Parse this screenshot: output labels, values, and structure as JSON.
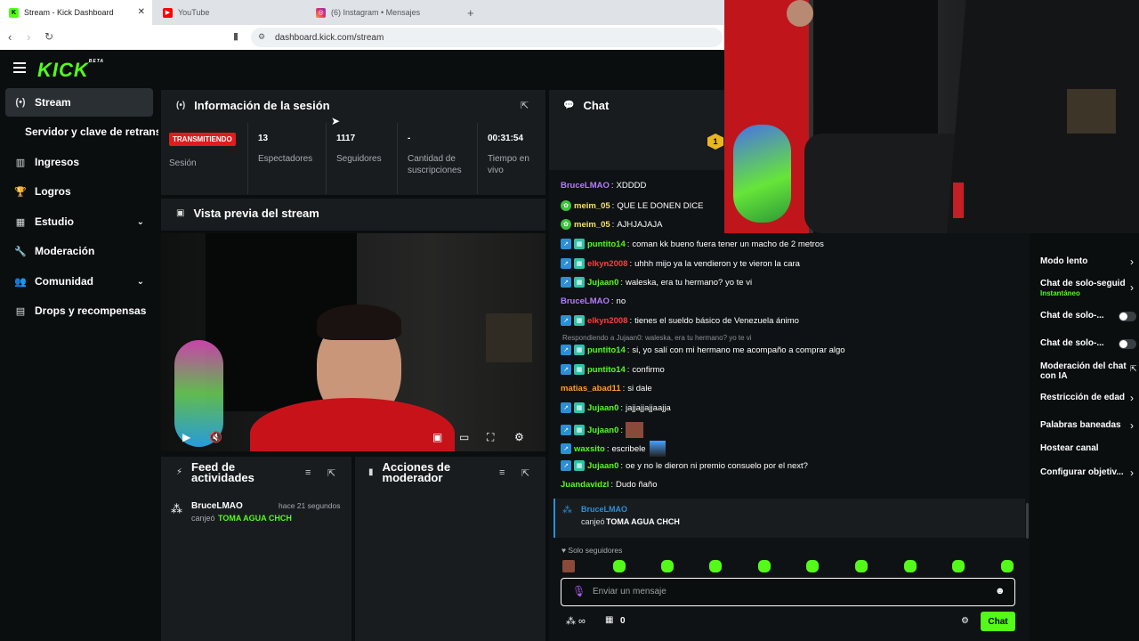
{
  "browser": {
    "tabs": [
      {
        "title": "Stream - Kick Dashboard",
        "active": true
      },
      {
        "title": "YouTube",
        "active": false
      },
      {
        "title": "(6) Instagram • Mensajes",
        "active": false
      }
    ],
    "url": "dashboard.kick.com/stream"
  },
  "brand": {
    "logo": "KICK",
    "logo_sup": "BETA",
    "accent": "#53fc18"
  },
  "sidebar": {
    "items": [
      {
        "label": "Stream",
        "icon": "broadcast-icon"
      },
      {
        "label": "Servidor y clave de retransmisión",
        "icon": ""
      },
      {
        "label": "Ingresos",
        "icon": "chart-icon"
      },
      {
        "label": "Logros",
        "icon": "trophy-icon"
      },
      {
        "label": "Estudio",
        "icon": "grid-icon"
      },
      {
        "label": "Moderación",
        "icon": "wrench-icon"
      },
      {
        "label": "Comunidad",
        "icon": "people-icon"
      },
      {
        "label": "Drops y recompensas",
        "icon": "gift-icon"
      }
    ]
  },
  "session": {
    "title": "Información de la sesión",
    "status_badge": "TRANSMITIENDO",
    "status_label": "Sesión",
    "stats": [
      {
        "value": "13",
        "label": "Espectadores"
      },
      {
        "value": "1117",
        "label": "Seguidores"
      },
      {
        "value": "-",
        "label": "Cantidad de suscripciones"
      },
      {
        "value": "00:31:54",
        "label": "Tiempo en vivo"
      }
    ]
  },
  "preview": {
    "title": "Vista previa del stream"
  },
  "activity": {
    "title": "Feed de actividades",
    "items": [
      {
        "user": "BruceLMAO",
        "time": "hace 21 segundos",
        "action": "canjeó",
        "reward": "TOMA AGUA CHCH"
      }
    ]
  },
  "mod_actions": {
    "title": "Acciones de moderador"
  },
  "chat": {
    "title": "Chat",
    "messages": [
      {
        "user": "BruceLMAO",
        "color": "#b57bff",
        "text": "XDDDD",
        "badges": []
      },
      {
        "user": "meim_05",
        "color": "#f6e35a",
        "text": "QUE LE DONEN DICE",
        "badges": [
          "green"
        ]
      },
      {
        "user": "meim_05",
        "color": "#f6e35a",
        "text": "AJHJAJAJA",
        "badges": [
          "green"
        ]
      },
      {
        "user": "puntito14",
        "color": "#53fc18",
        "text": "coman kk bueno fuera tener un macho de 2 metros",
        "badges": [
          "blue",
          "teal"
        ]
      },
      {
        "user": "elkyn2008",
        "color": "#ff3b3b",
        "text": "uhhh mijo ya la vendieron y te vieron la cara",
        "badges": [
          "blue",
          "teal"
        ]
      },
      {
        "user": "Jujaan0",
        "color": "#53fc18",
        "text": "waleska, era tu hermano? yo te vi",
        "badges": [
          "blue",
          "teal"
        ]
      },
      {
        "user": "BruceLMAO",
        "color": "#b57bff",
        "text": "no",
        "badges": []
      },
      {
        "user": "elkyn2008",
        "color": "#ff3b3b",
        "text": "tienes el sueldo básico de Venezuela ánimo",
        "badges": [
          "blue",
          "teal"
        ]
      },
      {
        "user": "puntito14",
        "color": "#53fc18",
        "text": "si, yo salí con mi hermano me acompaño a comprar algo",
        "badges": [
          "blue",
          "teal"
        ]
      },
      {
        "user": "puntito14",
        "color": "#53fc18",
        "text": "confirmo",
        "badges": [
          "blue",
          "teal"
        ]
      },
      {
        "user": "matias_abad11",
        "color": "#ff9d2e",
        "text": "si dale",
        "badges": []
      },
      {
        "user": "Jujaan0",
        "color": "#53fc18",
        "text": "jajjajjajjaajja",
        "badges": [
          "blue",
          "teal"
        ]
      },
      {
        "user": "Jujaan0",
        "color": "#53fc18",
        "text": "",
        "badges": [
          "blue",
          "teal"
        ]
      },
      {
        "user": "waxsito",
        "color": "#53fc18",
        "text": "escribele",
        "badges": [
          "blue"
        ]
      },
      {
        "user": "Jujaan0",
        "color": "#53fc18",
        "text": "oe y no le dieron ni premio consuelo por el next?",
        "badges": [
          "blue",
          "teal"
        ]
      },
      {
        "user": "Juandavidzl",
        "color": "#53fc18",
        "text": "Dudo ñaño",
        "badges": []
      }
    ],
    "reply_line": "Respondiendo a Jujaan0: waleska, era tu hermano? yo te vi",
    "redeem": {
      "user": "BruceLMAO",
      "action": "canjeó",
      "reward": "TOMA AGUA CHCH"
    },
    "followers_only": "Solo seguidores",
    "input_placeholder": "Enviar un mensaje",
    "counter": "0",
    "send_label": "Chat"
  },
  "settings": {
    "items": [
      {
        "label": "Modo lento",
        "control": "arrow"
      },
      {
        "label": "Chat de solo-seguid",
        "sub": "Instantáneo",
        "control": "arrow"
      },
      {
        "label": "Chat de solo-...",
        "control": "toggle"
      },
      {
        "label": "Chat de solo-...",
        "control": "toggle"
      },
      {
        "label": "Moderación del chat con IA",
        "control": "external"
      },
      {
        "label": "Restricción de edad",
        "control": "arrow"
      },
      {
        "label": "Palabras baneadas",
        "control": "arrow"
      },
      {
        "label": "Hostear canal",
        "control": "none"
      },
      {
        "label": "Configurar objetiv...",
        "control": "arrow"
      }
    ]
  }
}
